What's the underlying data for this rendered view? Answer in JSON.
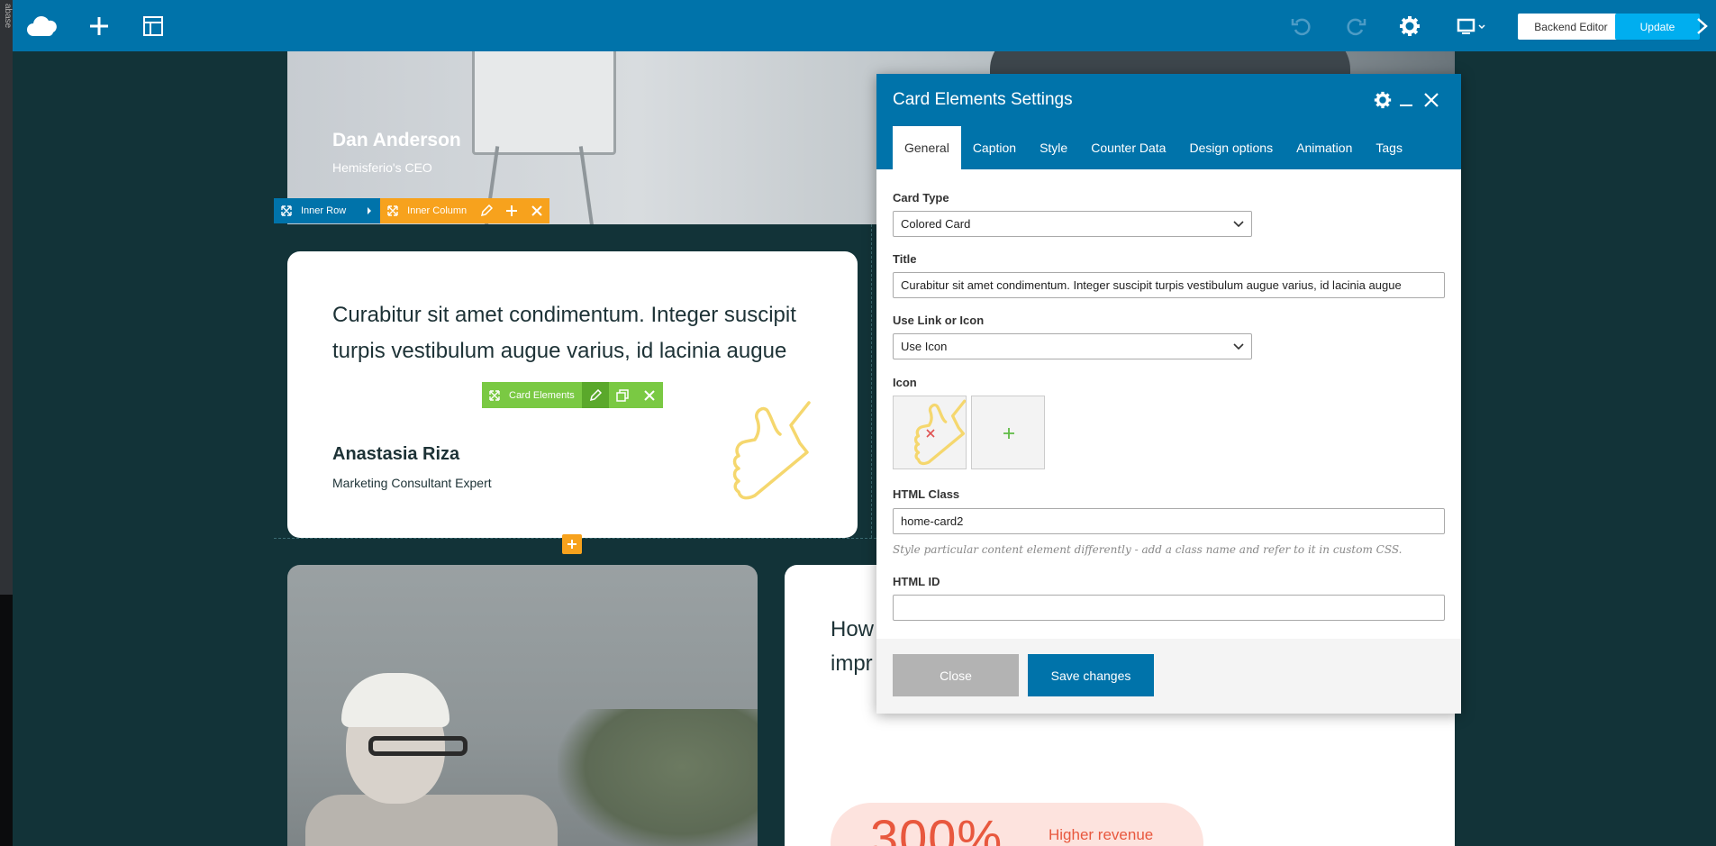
{
  "sidebar": {
    "vertical_text": "abase"
  },
  "topbar": {
    "backend_editor_label": "Backend Editor",
    "update_label": "Update",
    "colors": {
      "bar": "#0073aa",
      "update": "#00aeef"
    }
  },
  "page": {
    "testimonial_top": {
      "name": "Dan Anderson",
      "role": "Hemisferio's CEO"
    },
    "controls": {
      "inner_row": "Inner Row",
      "inner_column": "Inner Column",
      "card_elements": "Card Elements"
    },
    "card": {
      "title": "Curabitur sit amet condimentum. Integer suscipit turpis vestibulum augue varius, id lacinia augue",
      "name": "Anastasia Riza",
      "role": "Marketing Consultant Expert"
    },
    "right_section": {
      "title_line1": "How",
      "title_line2": "impr",
      "stat_value": "300%",
      "stat_label": "Higher revenue"
    }
  },
  "modal": {
    "title": "Card Elements Settings",
    "tabs": [
      "General",
      "Caption",
      "Style",
      "Counter Data",
      "Design options",
      "Animation",
      "Tags"
    ],
    "active_tab": "General",
    "fields": {
      "card_type_label": "Card Type",
      "card_type_value": "Colored Card",
      "title_label": "Title",
      "title_value": "Curabitur sit amet condimentum. Integer suscipit turpis vestibulum augue varius, id lacinia augue",
      "link_label": "Use Link or Icon",
      "link_value": "Use Icon",
      "icon_label": "Icon",
      "html_class_label": "HTML Class",
      "html_class_value": "home-card2",
      "html_class_help": "Style particular content element differently - add a class name and refer to it in custom CSS.",
      "html_id_label": "HTML ID",
      "html_id_value": ""
    },
    "buttons": {
      "close": "Close",
      "save": "Save changes"
    }
  }
}
